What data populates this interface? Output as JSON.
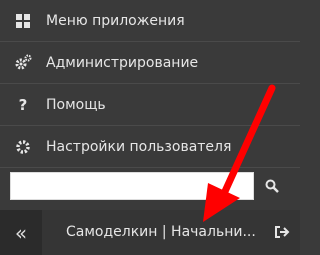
{
  "menu": {
    "items": [
      {
        "label": "Меню приложения",
        "icon": "grid-icon"
      },
      {
        "label": "Администрирование",
        "icon": "gears-icon"
      },
      {
        "label": "Помощь",
        "icon": "question-icon"
      },
      {
        "label": "Настройки пользователя",
        "icon": "gear-icon"
      }
    ]
  },
  "search": {
    "value": "",
    "placeholder": ""
  },
  "footer": {
    "collapse_label": "«",
    "user_label": "Самоделкин | Начальни...",
    "logout_icon": "logout-icon"
  },
  "colors": {
    "background": "#3a3a3a",
    "footer": "#353535",
    "arrow": "#ff0000"
  }
}
